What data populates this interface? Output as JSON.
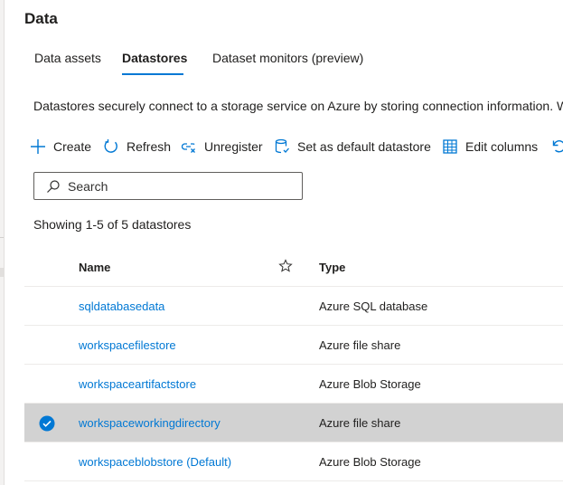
{
  "page": {
    "title": "Data"
  },
  "tabs": [
    {
      "label": "Data assets"
    },
    {
      "label": "Datastores"
    },
    {
      "label": "Dataset monitors (preview)"
    }
  ],
  "description": "Datastores securely connect to a storage service on Azure by storing connection information. W",
  "toolbar": {
    "create": "Create",
    "refresh": "Refresh",
    "unregister": "Unregister",
    "set_default": "Set as default datastore",
    "edit_columns": "Edit columns"
  },
  "search": {
    "placeholder": "Search",
    "value": ""
  },
  "showing": "Showing 1-5 of 5 datastores",
  "table": {
    "columns": {
      "name": "Name",
      "type": "Type"
    },
    "rows": [
      {
        "name": "sqldatabasedata",
        "type": "Azure SQL database",
        "selected": false
      },
      {
        "name": "workspacefilestore",
        "type": "Azure file share",
        "selected": false
      },
      {
        "name": "workspaceartifactstore",
        "type": "Azure Blob Storage",
        "selected": false
      },
      {
        "name": "workspaceworkingdirectory",
        "type": "Azure file share",
        "selected": true
      },
      {
        "name": "workspaceblobstore (Default)",
        "type": "Azure Blob Storage",
        "selected": false
      }
    ]
  },
  "colors": {
    "accent": "#0078d4",
    "selected_row": "#d2d2d2"
  }
}
